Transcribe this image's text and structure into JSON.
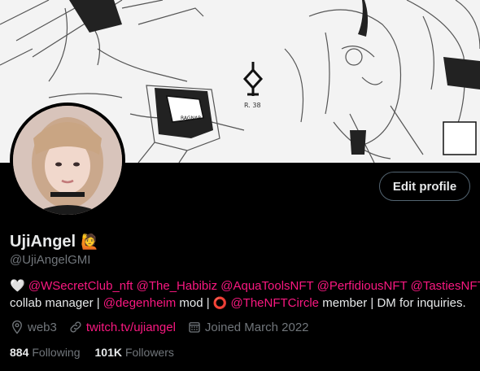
{
  "banner": {
    "caption": "R. 38"
  },
  "profile": {
    "name": "UjiAngel",
    "name_emoji": "🙋",
    "handle": "@UjiAngelGMI",
    "edit_button": "Edit profile"
  },
  "bio": {
    "heart": "🤍",
    "mentions": [
      "@WSecretClub_nft",
      "@The_Habibiz",
      "@AquaToolsNFT",
      "@PerfidiousNFT",
      "@TastiesNFT"
    ],
    "line2_a": "collab manager |",
    "line2_mention1": "@degenheim",
    "line2_b": "mod |",
    "ring": "⭕",
    "line2_mention2": "@TheNFTCircle",
    "line2_c": "member | DM for inquiries."
  },
  "meta": {
    "location": "web3",
    "website": "twitch.tv/ujiangel",
    "joined": "Joined March 2022"
  },
  "stats": {
    "following_count": "884",
    "following_label": "Following",
    "followers_count": "101K",
    "followers_label": "Followers"
  },
  "colors": {
    "accent": "#f91880",
    "muted": "#71767b",
    "text": "#e7e9ea",
    "background": "#000000"
  }
}
